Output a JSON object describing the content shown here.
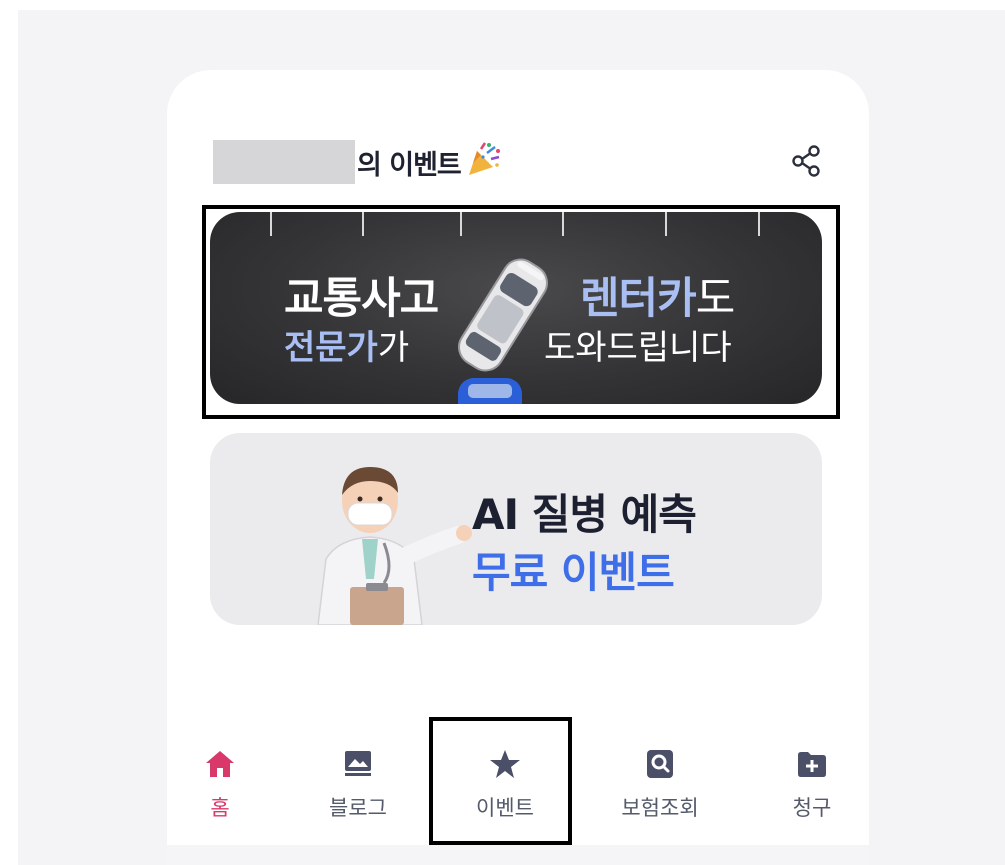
{
  "page": {
    "title_suffix": "의 이벤트",
    "party_icon": "party-popper-icon",
    "share_icon": "share-icon"
  },
  "banners": [
    {
      "name": "accident-rental-banner",
      "left_line1": "교통사고",
      "left_line2_blue": "전문가",
      "left_line2_rest": "가",
      "right_line1_blue": "렌터카",
      "right_line1_rest": "도",
      "right_line2": "도와드립니다"
    },
    {
      "name": "ai-disease-banner",
      "line1": "AI 질병 예측",
      "line2": "무료 이벤트"
    }
  ],
  "tabs": [
    {
      "label": "홈",
      "icon": "home-icon",
      "active": true
    },
    {
      "label": "블로그",
      "icon": "blog-icon",
      "active": false
    },
    {
      "label": "이벤트",
      "icon": "star-icon",
      "active": false
    },
    {
      "label": "보험조회",
      "icon": "search-icon",
      "active": false
    },
    {
      "label": "청구",
      "icon": "folder-plus-icon",
      "active": false
    }
  ],
  "colors": {
    "accent_active": "#d8396a",
    "tab_icon": "#4b4f68",
    "highlight_blue": "#3e6ee8",
    "banner_blue_text": "#a9bff4"
  }
}
